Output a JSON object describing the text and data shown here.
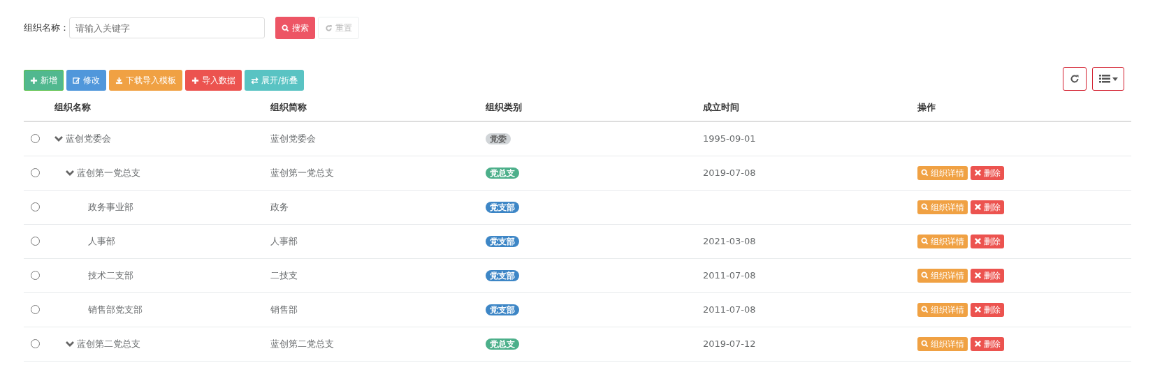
{
  "search": {
    "label": "组织名称：",
    "placeholder": "请输入关键字",
    "buttons": [
      {
        "kind": "search",
        "label": "搜索",
        "disabled": false
      },
      {
        "kind": "reset",
        "label": "重置",
        "disabled": true
      }
    ]
  },
  "toolbar": [
    {
      "kind": "add",
      "label": "新增"
    },
    {
      "kind": "edit",
      "label": "修改"
    },
    {
      "kind": "download",
      "label": "下载导入模板"
    },
    {
      "kind": "import",
      "label": "导入数据"
    },
    {
      "kind": "toggle",
      "label": "展开/折叠"
    }
  ],
  "table": {
    "columns": [
      "组织名称",
      "组织简称",
      "组织类别",
      "成立时间",
      "操作"
    ],
    "rows": [
      {
        "name": "蓝创党委会",
        "abbr": "蓝创党委会",
        "category": {
          "text": "党委",
          "color": "#d1d5d8"
        },
        "date": "1995-09-01",
        "selected": false,
        "expanded": true,
        "actions": [],
        "children": [
          {
            "name": "蓝创第一党总支",
            "abbr": "蓝创第一党总支",
            "category": {
              "text": "党总支",
              "color": "#4caf8a"
            },
            "date": "2019-07-08",
            "selected": false,
            "expanded": true,
            "actions": [
              {
                "kind": "detail",
                "label": "组织详情"
              },
              {
                "kind": "delete",
                "label": "删除"
              }
            ],
            "children": [
              {
                "name": "政务事业部",
                "abbr": "政务",
                "category": {
                  "text": "党支部",
                  "color": "#3d86c6"
                },
                "selected": false,
                "actions": [
                  {
                    "kind": "detail",
                    "label": "组织详情"
                  },
                  {
                    "kind": "delete",
                    "label": "删除"
                  }
                ]
              },
              {
                "name": "人事部",
                "abbr": "人事部",
                "category": {
                  "text": "党支部",
                  "color": "#3d86c6"
                },
                "date": "2021-03-08",
                "selected": false,
                "actions": [
                  {
                    "kind": "detail",
                    "label": "组织详情"
                  },
                  {
                    "kind": "delete",
                    "label": "删除"
                  }
                ]
              },
              {
                "name": "技术二支部",
                "abbr": "二技支",
                "category": {
                  "text": "党支部",
                  "color": "#3d86c6"
                },
                "date": "2011-07-08",
                "selected": false,
                "actions": [
                  {
                    "kind": "detail",
                    "label": "组织详情"
                  },
                  {
                    "kind": "delete",
                    "label": "删除"
                  }
                ]
              },
              {
                "name": "销售部党支部",
                "abbr": "销售部",
                "category": {
                  "text": "党支部",
                  "color": "#3d86c6"
                },
                "date": "2011-07-08",
                "selected": false,
                "actions": [
                  {
                    "kind": "detail",
                    "label": "组织详情"
                  },
                  {
                    "kind": "delete",
                    "label": "删除"
                  }
                ]
              }
            ]
          },
          {
            "name": "蓝创第二党总支",
            "abbr": "蓝创第二党总支",
            "category": {
              "text": "党总支",
              "color": "#4caf8a"
            },
            "date": "2019-07-12",
            "selected": false,
            "expanded": true,
            "actions": [
              {
                "kind": "detail",
                "label": "组织详情"
              },
              {
                "kind": "delete",
                "label": "删除"
              }
            ]
          }
        ]
      }
    ]
  }
}
